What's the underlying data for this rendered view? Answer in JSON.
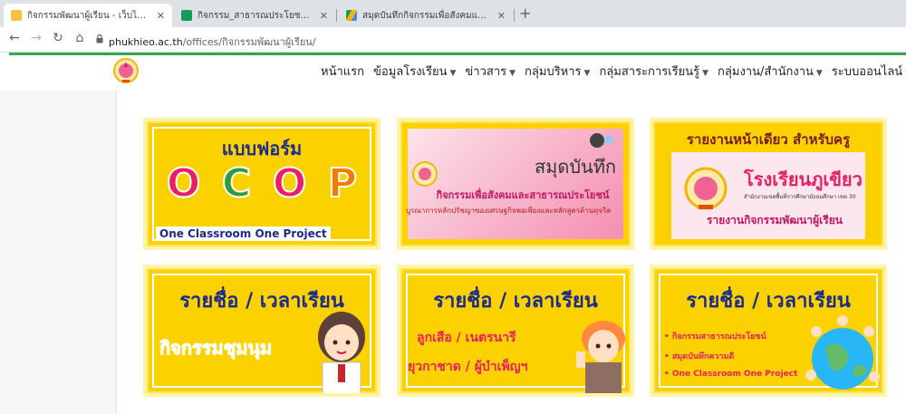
{
  "browser": {
    "tabs": [
      {
        "title": "กิจกรรมพัฒนาผู้เรียน - เว็บไซต์โรงเรียน",
        "favicon_color": "#f5c542"
      },
      {
        "title": "กิจกรรม_สาธารณประโยชน์ ภาคเรียน",
        "favicon_color": "#0f9d58"
      },
      {
        "title": "สมุดบันทึกกิจกรรมเพื่อสังคมและสาธารณ",
        "favicon_color": "#4285f4"
      }
    ],
    "url_host": "phukhieo.ac.th",
    "url_path": "/offices/กิจกรรมพัฒนาผู้เรียน/"
  },
  "nav": {
    "items": [
      {
        "label": "หน้าแรก",
        "dropdown": false
      },
      {
        "label": "ข้อมูลโรงเรียน",
        "dropdown": true
      },
      {
        "label": "ข่าวสาร",
        "dropdown": true
      },
      {
        "label": "กลุ่มบริหาร",
        "dropdown": true
      },
      {
        "label": "กลุ่มสาระการเรียนรู้",
        "dropdown": true
      },
      {
        "label": "กลุ่มงาน/สำนักงาน",
        "dropdown": true
      },
      {
        "label": "ระบบออนไลน์",
        "dropdown": true
      }
    ]
  },
  "cards": {
    "ocop": {
      "title": "แบบฟอร์ม",
      "letters": [
        "O",
        "C",
        "O",
        "P"
      ],
      "letter_colors": [
        "#e91e63",
        "#2e9d3a",
        "#e91e63",
        "#f57c00"
      ],
      "subtitle": "One Classroom One Project"
    },
    "notebook": {
      "title": "สมุดบันทึก",
      "subtitle": "กิจกรรมเพื่อสังคมและสาธารณประโยชน์",
      "line": "บูรณาการหลักปรัชญาของเศรษฐกิจพอเพียงและหลักสูตรต้านทุจริต"
    },
    "report": {
      "title": "รายงานหน้าเดียว สำหรับครู",
      "school": "โรงเรียนภูเขียว",
      "tiny": "สำนักงานเขตพื้นที่การศึกษามัธยมศึกษา เขต 30",
      "bottom": "รายงานกิจกรรมพัฒนาผู้เรียน"
    },
    "clubs": {
      "title": "รายชื่อ / เวลาเรียน",
      "subtitle": "กิจกรรมชุมนุม"
    },
    "scouts": {
      "title": "รายชื่อ / เวลาเรียน",
      "line1": "ลูกเสือ / เนตรนารี",
      "line2": "ยุวกาชาด / ผู้บำเพ็ญฯ"
    },
    "public": {
      "title": "รายชื่อ / เวลาเรียน",
      "bullets": [
        "• กิจกรรมสาธารณประโยชน์",
        "• สมุดบันทึกความดี",
        "• One Classroom One Project"
      ]
    }
  }
}
